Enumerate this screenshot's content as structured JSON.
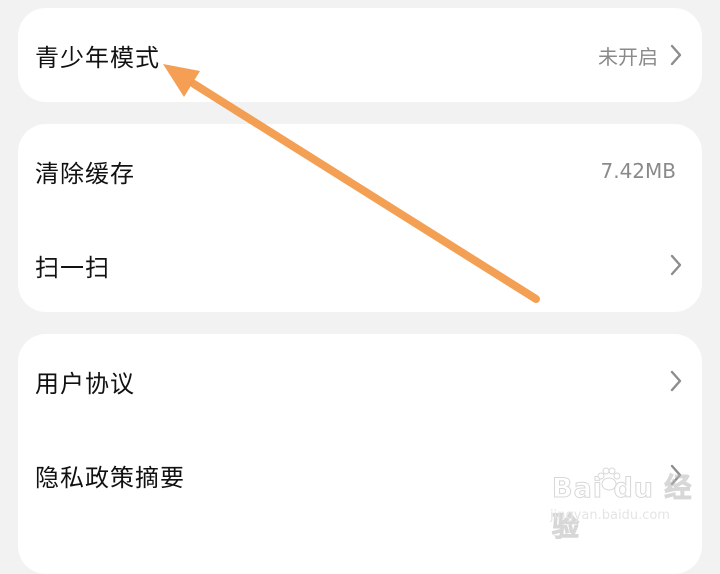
{
  "settings": {
    "teen_mode": {
      "label": "青少年模式",
      "value": "未开启"
    },
    "clear_cache": {
      "label": "清除缓存",
      "value": "7.42MB"
    },
    "scan": {
      "label": "扫一扫"
    },
    "user_agreement": {
      "label": "用户协议"
    },
    "privacy_summary": {
      "label": "隐私政策摘要"
    }
  },
  "watermark": {
    "logo_text": "Bai du 经验",
    "url": "jingyan.baidu.com"
  },
  "annotation": {
    "arrow_color": "#f39a4b",
    "points_to": "青少年模式"
  },
  "icons": {
    "chevron": "chevron-right-icon",
    "annotation": "arrow-annotation-icon"
  }
}
